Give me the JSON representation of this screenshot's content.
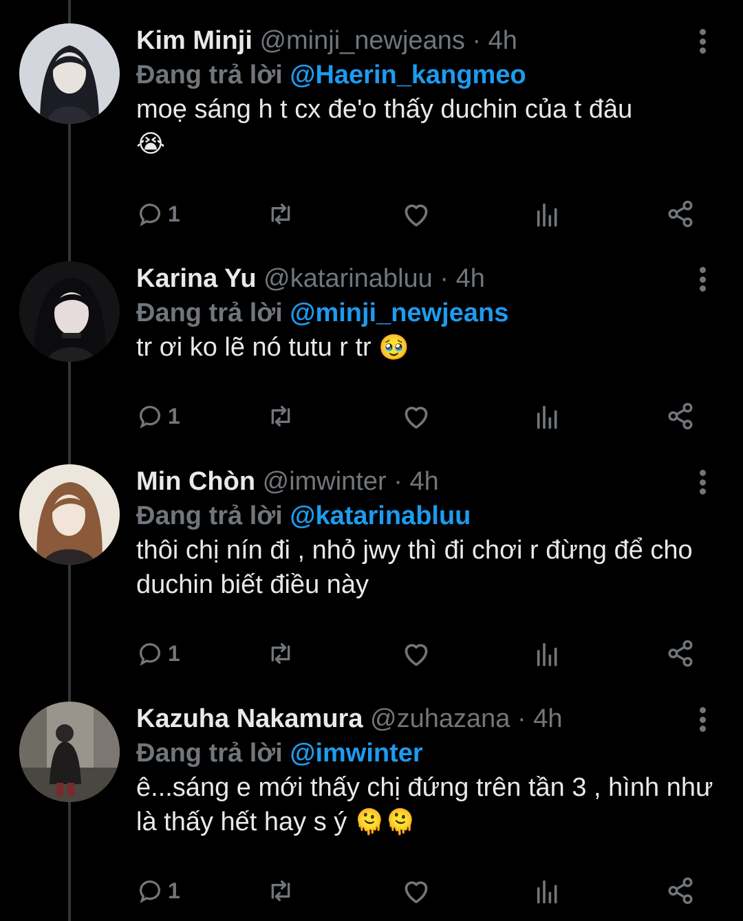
{
  "tweets": [
    {
      "name": "Kim Minji",
      "handle": "@minji_newjeans",
      "dot": "·",
      "time": "4h",
      "replying_label": "Đang trả lời",
      "replying_to": "@Haerin_kangmeo",
      "text": "moẹ sáng h t cx đe'o thấy duchin của t đâu",
      "emoji": "😭",
      "reply_count": "1",
      "avatar_colors": [
        "#c9ccd6",
        "#1a1a22"
      ]
    },
    {
      "name": "Karina Yu",
      "handle": "@katarinabluu",
      "dot": "·",
      "time": "4h",
      "replying_label": "Đang trả lời",
      "replying_to": "@minji_newjeans",
      "text": "tr ơi ko lẽ nó tutu r tr",
      "emoji": "🥹",
      "reply_count": "1",
      "avatar_colors": [
        "#2a2a2e",
        "#d8d2d2"
      ]
    },
    {
      "name": "Min Chòn",
      "handle": "@imwinter",
      "dot": "·",
      "time": "4h",
      "replying_label": "Đang trả lời",
      "replying_to": "@katarinabluu",
      "text": "thôi chị nín đi , nhỏ jwy thì đi chơi r đừng để cho duchin biết điều này",
      "emoji": "",
      "reply_count": "1",
      "avatar_colors": [
        "#e9e2d8",
        "#8a5a3a"
      ]
    },
    {
      "name": "Kazuha Nakamura",
      "handle": "@zuhazana",
      "dot": "·",
      "time": "4h",
      "replying_label": "Đang trả lời",
      "replying_to": "@imwinter",
      "text": "ê...sáng e mới thấy chị đứng trên tần 3 , hình như là thấy hết hay s ý",
      "emoji": "🫠🫠",
      "reply_count": "1",
      "avatar_colors": [
        "#8e8a84",
        "#2b2a2a"
      ]
    }
  ],
  "icons": [
    "reply-icon",
    "retweet-icon",
    "like-icon",
    "views-icon",
    "share-icon",
    "more-icon"
  ],
  "colors": {
    "background": "#000000",
    "text": "#e7e9ea",
    "secondary": "#71767b",
    "mention": "#1d9bf0",
    "thread_line": "#333639"
  }
}
